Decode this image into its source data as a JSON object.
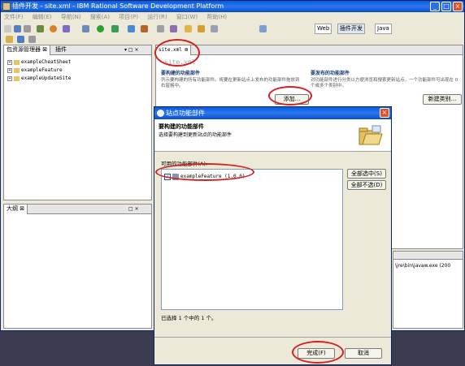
{
  "window": {
    "title": "插件开发 - site.xml - IBM Rational Software Development Platform"
  },
  "menubar": [
    "文件(F)",
    "编辑(E)",
    "导航(N)",
    "搜索(A)",
    "项目(P)",
    "运行(R)",
    "窗口(W)",
    "帮助(H)"
  ],
  "perspectives": {
    "web": "Web",
    "plugin": "插件开发",
    "java": "Java"
  },
  "left_panel": {
    "tabs": [
      "包资源管理器",
      "插件"
    ],
    "tree": [
      "exampleCheatSheet",
      "exampleFeature",
      "exampleUpdateSite"
    ]
  },
  "outline_panel": {
    "tab": "大纲"
  },
  "editor": {
    "tab": "site.xml",
    "header": "site.xml",
    "features_section": {
      "title": "要构建的功能部件",
      "desc": "列示要构建的所有功能部件。将要在更新站点上发布的功能部件拖放到右窗格中。",
      "add_button": "添加..."
    },
    "publish_section": {
      "title": "要发布的功能部件",
      "desc": "对功能部件进行分类以方便浏览和搜索更新站点。一个功能部件可出现在 0 个或多个类别中。",
      "new_category_button": "新建类别..."
    },
    "console_text": "\\jre\\bin\\javaw.exe (200"
  },
  "dialog": {
    "title": "站点功能部件",
    "header_title": "要构建的功能部件",
    "header_desc": "选择要构建到更新站点的功能部件",
    "list_label": "可用的功能部件(A):",
    "features": [
      {
        "label": "exampleFeature (1.0.0)",
        "checked": true
      }
    ],
    "select_all": "全部选中(S)",
    "deselect_all": "全部不选(D)",
    "status": "已选择 1 个中的 1 个。",
    "finish": "完成(F)",
    "cancel": "取消"
  }
}
